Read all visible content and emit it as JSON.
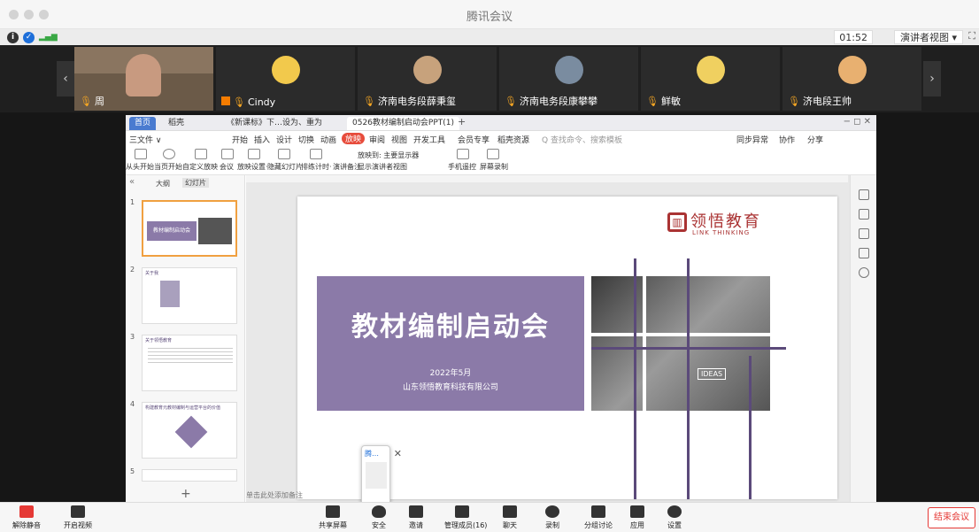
{
  "window": {
    "title": "腾讯会议"
  },
  "topbar": {
    "timer": "01:52",
    "view_mode": "演讲者视图 ▾"
  },
  "participants": [
    {
      "name": "周"
    },
    {
      "name": "Cindy"
    },
    {
      "name": "济南电务段薛秉玺"
    },
    {
      "name": "济南电务段康攀攀"
    },
    {
      "name": "鲜敏"
    },
    {
      "name": "济电段王帅"
    }
  ],
  "ppt": {
    "tabs": [
      "首页",
      "稻壳",
      "《新课标》下…设为、重为",
      "0526教材编制启动会PPT(1)"
    ],
    "menu": [
      "三文件 ∨",
      "开始",
      "插入",
      "设计",
      "切换",
      "动画",
      "放映",
      "审阅",
      "视图",
      "开发工具",
      "会员专享",
      "稻壳资源",
      "Q 查找命令、搜索模板",
      "同步异常",
      "协作",
      "分享"
    ],
    "ribbon": [
      "从头开始",
      "当页开始",
      "自定义放映",
      "会议",
      "放映设置·",
      "隐藏幻灯片",
      "排练计时·",
      "演讲备注",
      "显示演讲者视图",
      "手机遥控",
      "屏幕录制"
    ],
    "ribbon_option": "放映到: 主要显示器",
    "sidebar_tabs": [
      "大纲",
      "幻灯片"
    ],
    "thumb_numbers": [
      "1",
      "2",
      "3",
      "4",
      "5"
    ],
    "thumb_titles": [
      "教材编制启动会",
      "关于我",
      "关于领悟教育",
      "构建教育元教材编制与运营平台的价值"
    ],
    "notes_placeholder": "单击此处添加备注"
  },
  "slide": {
    "brand_cn": "领悟教育",
    "brand_en": "LINK THINKING",
    "title": "教材编制启动会",
    "date": "2022年5月",
    "company": "山东领悟教育科技有限公司",
    "photo_text": "IDEAS"
  },
  "popup": {
    "label": "腾…"
  },
  "bottombar": {
    "left": [
      "解除静音",
      "开启视频"
    ],
    "center": [
      "共享屏幕",
      "安全",
      "邀请",
      "管理成员(16)",
      "聊天",
      "录制",
      "分组讨论",
      "应用",
      "设置"
    ],
    "end": "结束会议"
  },
  "colors": {
    "accent": "#8b7aa8",
    "dark_accent": "#5b4a7a",
    "end_red": "#e53935",
    "mic_orange": "#f5a623"
  }
}
